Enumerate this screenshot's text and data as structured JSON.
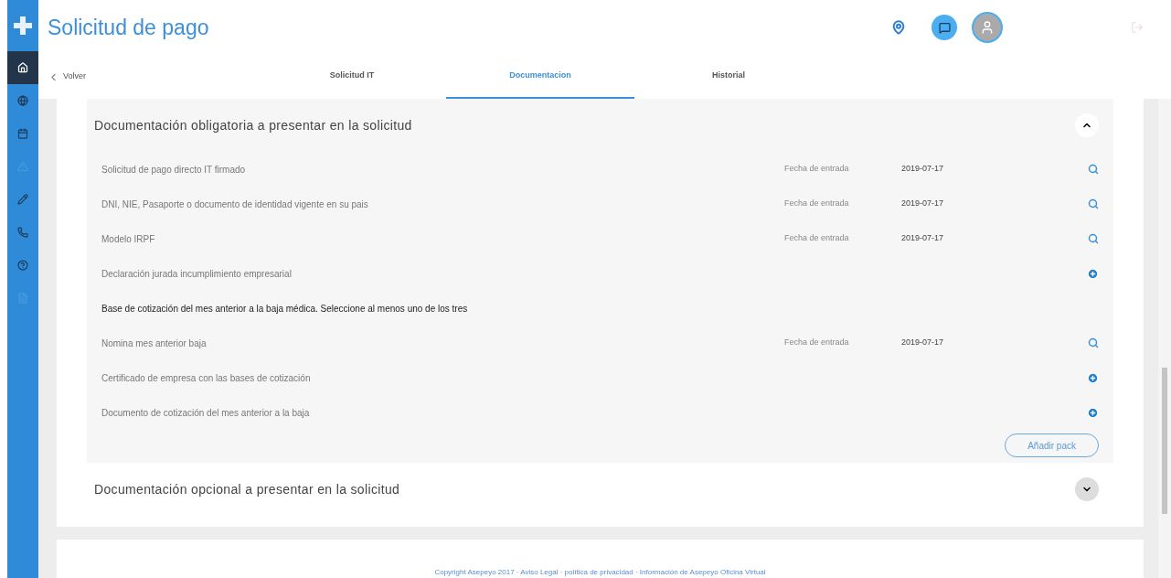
{
  "header": {
    "title": "Solicitud de pago"
  },
  "sidebar": {
    "items": [
      {
        "kind": "home",
        "selected": true,
        "disabled": false
      },
      {
        "kind": "globe",
        "selected": false,
        "disabled": false
      },
      {
        "kind": "calendar",
        "selected": false,
        "disabled": false
      },
      {
        "kind": "warning",
        "selected": false,
        "disabled": true
      },
      {
        "kind": "pencil",
        "selected": false,
        "disabled": false
      },
      {
        "kind": "phone",
        "selected": false,
        "disabled": false
      },
      {
        "kind": "help",
        "selected": false,
        "disabled": false
      },
      {
        "kind": "document",
        "selected": false,
        "disabled": true
      }
    ]
  },
  "nav": {
    "back": "Volver",
    "tabs": [
      {
        "label": "Solicitud IT",
        "selected": false
      },
      {
        "label": "Documentacion",
        "selected": true
      },
      {
        "label": "Historial",
        "selected": false
      }
    ]
  },
  "sections": [
    {
      "title": "Documentación obligatoria a presentar en la solicitud",
      "expanded": true,
      "rows": [
        {
          "kind": "uploaded",
          "name": "Solicitud de pago directo IT firmado",
          "date_label": "Fecha de entrada",
          "date": "2019-07-17"
        },
        {
          "kind": "uploaded",
          "name": "DNI, NIE, Pasaporte o documento de identidad vigente en su pais",
          "date_label": "Fecha de entrada",
          "date": "2019-07-17"
        },
        {
          "kind": "uploaded",
          "name": "Modelo IRPF",
          "date_label": "Fecha de entrada",
          "date": "2019-07-17"
        },
        {
          "kind": "pending",
          "name": "Declaración jurada incumplimiento empresarial"
        },
        {
          "kind": "heading",
          "name": "Base de cotización del mes anterior a la baja médica. Seleccione al menos uno de los tres"
        },
        {
          "kind": "uploaded",
          "name": "Nomina mes anterior baja",
          "date_label": "Fecha de entrada",
          "date": "2019-07-17"
        },
        {
          "kind": "pending",
          "name": "Certificado de empresa con las bases de cotización"
        },
        {
          "kind": "pending",
          "name": "Documento de cotización del mes anterior a la baja"
        }
      ],
      "button": "Añadir pack"
    },
    {
      "title": "Documentación opcional a presentar en la solicitud",
      "expanded": false
    }
  ],
  "footer": "Copyright Asepeyo 2017 · Aviso Legal · política de privacidad · Información de Asepeyo Oficina Virtual"
}
